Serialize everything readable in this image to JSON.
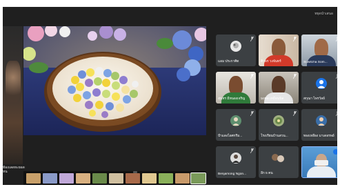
{
  "meeting": {
    "top_right_label": "หยุดนำเสนอ",
    "side_label_line1": "ท้องเลดหะยอด",
    "side_label_line2": "หน"
  },
  "participants": [
    {
      "name": "แอม ประกาศิต",
      "kind": "avatar",
      "avatar_color": "#e8e8e8",
      "mic": "muted"
    },
    {
      "name": "ศิวพร วงจันทร์",
      "kind": "video",
      "mic": "muted"
    },
    {
      "name": "Suwitcha Som...",
      "kind": "video",
      "mic": "muted"
    },
    {
      "name": "สุนทร มีหนองเจริญ",
      "kind": "video",
      "mic": "muted"
    },
    {
      "name": "มงคล เหมือนนิล",
      "kind": "video",
      "mic": "muted"
    },
    {
      "name": "สกุณา ไพรวัลย์",
      "kind": "avatar",
      "avatar_color": "#1a73e8",
      "mic": "muted"
    },
    {
      "name": "ป้าแดงไอศกรีม...",
      "kind": "avatar",
      "avatar_color": "#5f8f6f",
      "mic": "muted"
    },
    {
      "name": "โรงเรียนบ้านสวน...",
      "kind": "avatar",
      "avatar_color": "#a0b080",
      "mic": "muted"
    },
    {
      "name": "ทองเหลือง มาเดอรพย์",
      "kind": "avatar",
      "avatar_color": "#3a6ea8",
      "mic": "muted"
    },
    {
      "name": "Benjamong Ngon...",
      "kind": "avatar",
      "avatar_color": "#dddddd",
      "mic": "muted"
    },
    {
      "name": "อีก 5 คน",
      "kind": "more",
      "mic": "none"
    },
    {
      "name": "",
      "kind": "self",
      "mic": "active"
    }
  ],
  "filmstrip": {
    "count": 11,
    "selected_index": 10
  }
}
